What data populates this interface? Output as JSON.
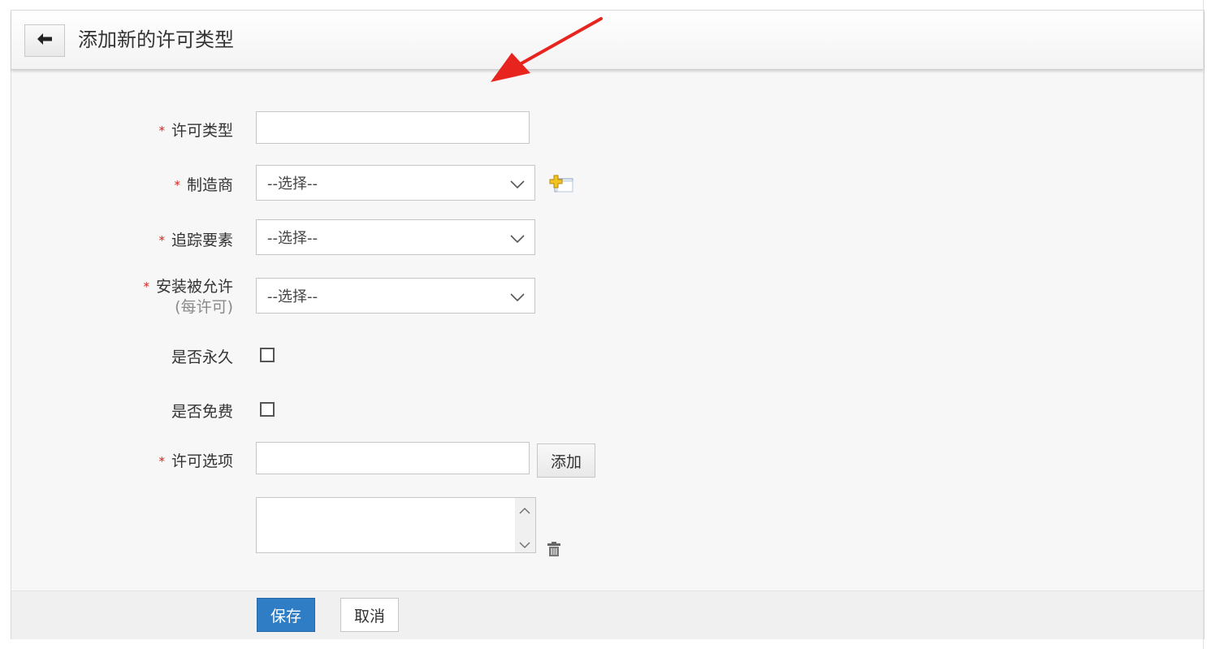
{
  "header": {
    "title": "添加新的许可类型",
    "back_icon": "arrow-left-icon"
  },
  "form": {
    "license_type": {
      "label": "许可类型",
      "required": true,
      "value": ""
    },
    "manufacturer": {
      "label": "制造商",
      "required": true,
      "selected": "--选择--",
      "add_icon": "add-manufacturer-icon"
    },
    "tracking_element": {
      "label": "追踪要素",
      "required": true,
      "selected": "--选择--"
    },
    "installs_allowed": {
      "label": "安装被允许",
      "sublabel": "(每许可)",
      "required": true,
      "selected": "--选择--"
    },
    "is_perpetual": {
      "label": "是否永久",
      "checked": false
    },
    "is_free": {
      "label": "是否免费",
      "checked": false
    },
    "license_options": {
      "label": "许可选项",
      "required": true,
      "value": "",
      "add_label": "添加",
      "delete_icon": "trash-icon"
    }
  },
  "footer": {
    "save_label": "保存",
    "cancel_label": "取消"
  },
  "colors": {
    "required": "#d9241c",
    "primary": "#2f7ec5",
    "annotation_arrow": "#e8241f"
  }
}
